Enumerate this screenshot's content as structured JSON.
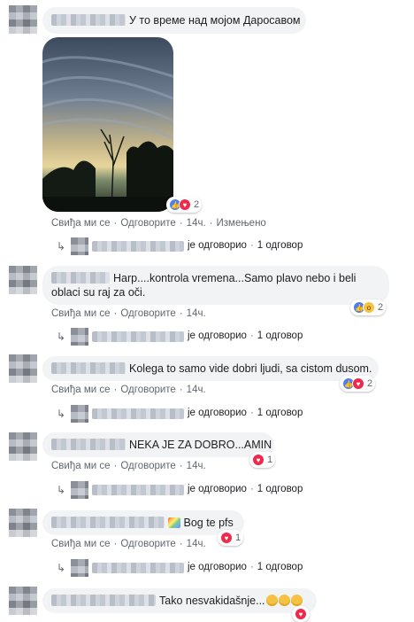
{
  "actions": {
    "like": "Свиђа ми се",
    "reply": "Одговорите",
    "edited": "Измењено",
    "sep": "·"
  },
  "comments": [
    {
      "text": "У то време над мојом Даросавом",
      "time": "14ч.",
      "reactions": "2",
      "reply_text": "је одговорио",
      "reply_count": "1 одговор"
    },
    {
      "text_line1": "Harp....kontrola vremena...Samo plavo nebo i beli",
      "text_line2": "oblaci su raj za oči.",
      "time": "14ч.",
      "reactions": "2",
      "reply_text": "je одговорио",
      "reply_count": "1 одговор"
    },
    {
      "text": "Kolega to samo vide dobri ljudi, sa cistom dusom.",
      "time": "14ч.",
      "reactions": "2",
      "reply_text": "je одговорио",
      "reply_count": "1 одговор"
    },
    {
      "text": "NEKA JE ZA DOBRO...AMIN",
      "time": "14ч.",
      "reactions": "1",
      "reply_text": "je одговорио",
      "reply_count": "1 одговор"
    },
    {
      "text": "Bog te pfs",
      "time": "14ч.",
      "reactions": "1",
      "reply_text": "je одговорио",
      "reply_count": "1 одговор"
    },
    {
      "text": "Tako nesvakidašnje..."
    }
  ],
  "icons": {
    "reply_arrow": "reply-arrow-icon",
    "like": "like-icon",
    "love": "love-icon",
    "wow": "wow-icon",
    "rainbow": "rainbow-emoji",
    "smiley": "smiley-emoji"
  },
  "colors": {
    "bubble": "#f2f3f5",
    "link": "#385898",
    "meta": "#606770",
    "like": "#4b7ef5",
    "love": "#f0284a"
  }
}
